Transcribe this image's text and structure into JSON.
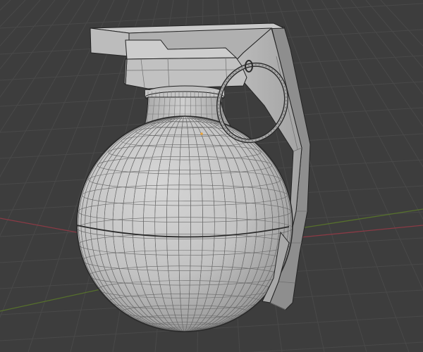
{
  "viewport": {
    "background_color": "#3d3d3d",
    "grid_line_color": "#494949",
    "x_axis_color": "#8a3a45",
    "y_axis_color": "#56702c"
  },
  "scene": {
    "object": "grenade-mesh",
    "shading": "solid",
    "overlay": "wireframe",
    "mesh_color": "#c4c4c4",
    "wire_color": "#6a6a6a",
    "edge_color": "#232323",
    "origin_color": "#e8a23a"
  }
}
